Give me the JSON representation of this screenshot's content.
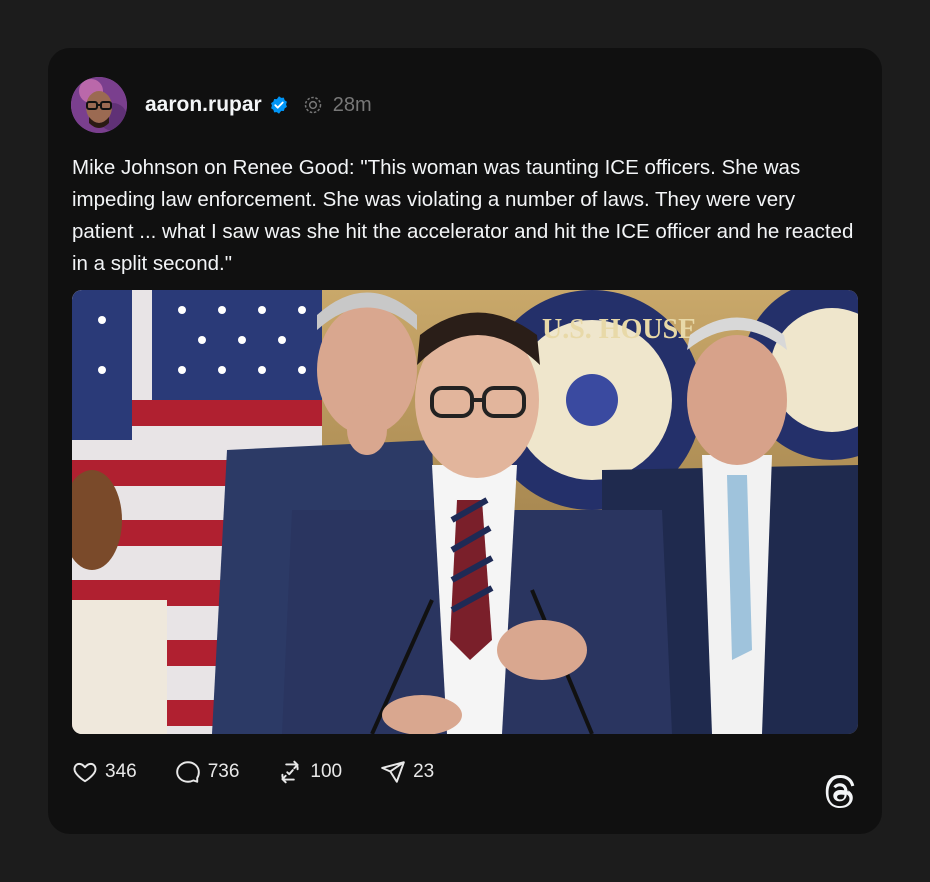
{
  "post": {
    "username": "aaron.rupar",
    "time": "28m",
    "text": "Mike Johnson on Renee Good: \"This woman was taunting ICE officers. She was impeding law enforcement. She was violating a number of laws. They were very patient ... what I saw was she hit the accelerator and hit the ICE officer and he reacted in a split second.\""
  },
  "media": {
    "seal_text": "U.S. HOUSE"
  },
  "actions": {
    "likes": "346",
    "replies": "736",
    "reposts": "100",
    "shares": "23"
  },
  "icons": {
    "verified": "verified-badge-icon",
    "threads_mini": "threads-fediverse-icon",
    "like": "heart-icon",
    "reply": "comment-icon",
    "repost": "repost-icon",
    "share": "send-icon",
    "logo": "threads-logo-icon"
  },
  "colors": {
    "background": "#1c1c1c",
    "card": "#101010",
    "verified": "#0095f6",
    "text": "#f3f5f7"
  }
}
